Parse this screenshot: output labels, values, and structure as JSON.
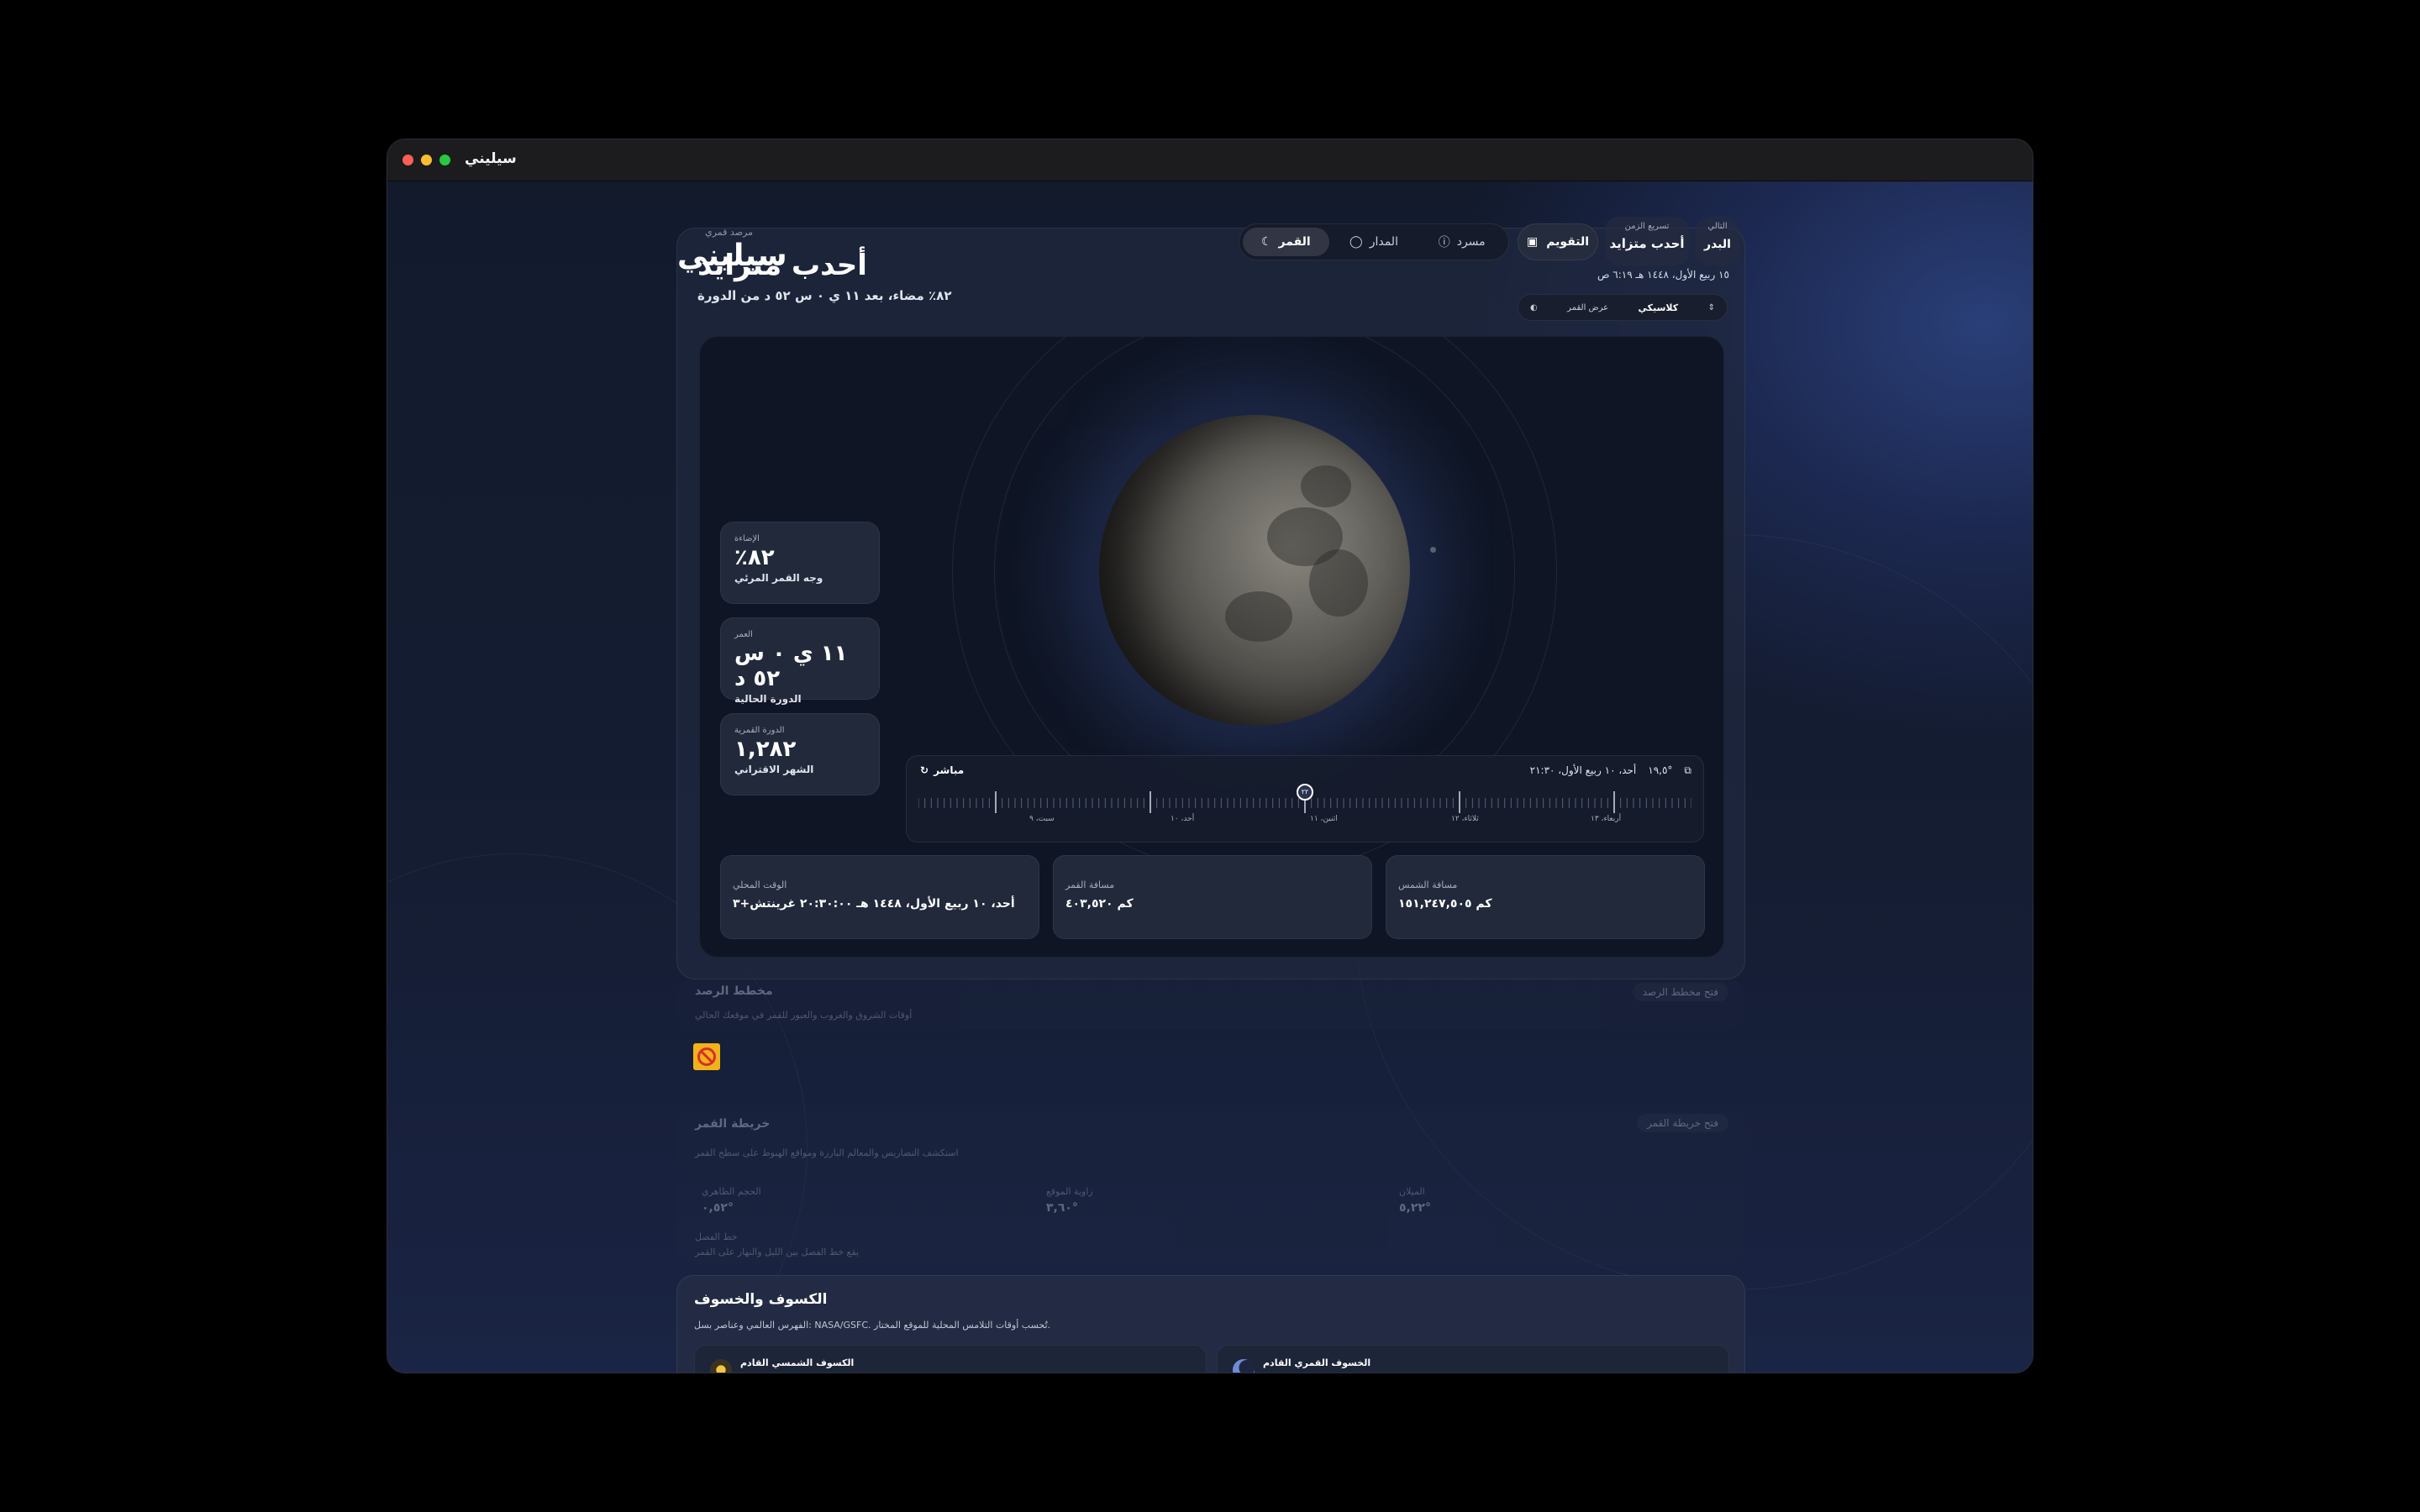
{
  "window": {
    "title": "سيليني"
  },
  "breadcrumb": {
    "text": "مرصد قمري"
  },
  "header": {
    "ghost_title": "سيليني",
    "title": "أحدب متزايد",
    "subtitle": "٨٢٪ مضاء، بعد ١١ ي ٠ س ٥٢ د من الدورة"
  },
  "view_tabs": [
    {
      "label": "القمر",
      "icon": "moon-icon",
      "active": true
    },
    {
      "label": "المدار",
      "icon": "orbit-icon",
      "active": false
    },
    {
      "label": "مسرد",
      "icon": "question-icon",
      "active": false
    }
  ],
  "calendar_button": {
    "label": "التقويم",
    "icon": "calendar-icon"
  },
  "time_speed": {
    "label": "تسريع الزمن",
    "value": "أحدب متزايد"
  },
  "next_phase": {
    "label": "التالي",
    "value": "البدر"
  },
  "date_line": "١٥ ربيع الأول، ١٤٤٨ هـ ٦:١٩ ص",
  "moon_mode": {
    "label": "عرض القمر",
    "value": "كلاسيكي"
  },
  "stats": [
    {
      "key": "الإضاءة",
      "value": "٪٨٢",
      "sub": "وجه القمر المرئي"
    },
    {
      "key": "العمر",
      "value": "١١ ي ٠ س ٥٢ د",
      "sub": "الدورة الحالية"
    },
    {
      "key": "الدورة القمرية",
      "value": "١,٢٨٢",
      "sub": "الشهر الاقتراني"
    }
  ],
  "timeline": {
    "live_label": "مباشر",
    "date": "أحد، ١٠ ربيع الأول، ٢١:٣٠",
    "angle": "١٩,٥°",
    "handle_label": "٢٢",
    "day_labels": [
      "سبت، ٩",
      "أحد، ١٠",
      "اثنين، ١١",
      "ثلاثاء، ١٢",
      "أربعاء، ١٣"
    ]
  },
  "info_cards": [
    {
      "key": "الوقت المحلي",
      "value": "أحد، ١٠ ربيع الأول، ١٤٤٨ هـ ٢٠:٣٠:٠٠ غرينتش+٣"
    },
    {
      "key": "مسافة القمر",
      "value": "كم ٤٠٣,٥٢٠"
    },
    {
      "key": "مسافة الشمس",
      "value": "كم ١٥١,٢٤٧,٥٠٥"
    }
  ],
  "observation_plan": {
    "title": "مخطط الرصد",
    "description": "أوقات الشروق والغروب والعبور للقمر في موقعك الحالي",
    "button": "فتح مخطط الرصد"
  },
  "moon_map": {
    "title": "خريطة القمر",
    "description": "استكشف التضاريس والمعالم البارزة ومواقع الهبوط على سطح القمر",
    "button": "فتح خريطة القمر",
    "metrics": [
      {
        "key": "الحجم الظاهري",
        "value": "٠,٥٢°"
      },
      {
        "key": "زاوية الموقع",
        "value": "٣,٦٠°"
      },
      {
        "key": "الميلان",
        "value": "٥,٢٢°"
      }
    ],
    "note_title": "خط الفصل",
    "note_text": "يقع خط الفصل بين الليل والنهار على القمر"
  },
  "eclipses": {
    "title": "الكسوف والخسوف",
    "description": "الفهرس العالمي وعناصر بسل: NASA/GSFC. تُحسب أوقات التلامس المحلية للموقع المختار.",
    "solar_title": "الكسوف الشمسي القادم",
    "lunar_title": "الخسوف القمري القادم"
  },
  "colors": {
    "accent": "#2b3f78",
    "background": "#131a2d",
    "moon": "#6a6862"
  }
}
